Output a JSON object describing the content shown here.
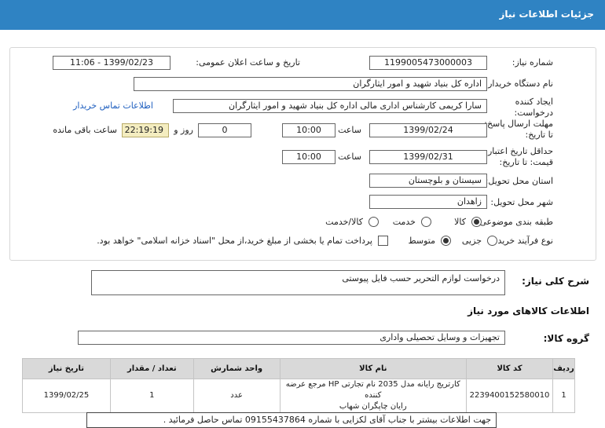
{
  "header": {
    "title": "جزئیات اطلاعات نیاز"
  },
  "form": {
    "need_number_label": "شماره نیاز:",
    "need_number": "1199005473000003",
    "announce_label": "تاریخ و ساعت اعلان عمومی:",
    "announce_value": "1399/02/23 - 11:06",
    "buyer_label": "نام دستگاه خریدار:",
    "buyer_value": "اداره کل بنیاد شهید و امور ایثارگران",
    "creator_label_1": "ایجاد کننده",
    "creator_label_2": "درخواست:",
    "creator_value": "سارا کریمی کارشناس اداری مالی اداره کل بنیاد شهید و امور ایثارگران",
    "contact_link": "اطلاعات تماس خریدار",
    "reply_label_1": "مهلت ارسال پاسخ:",
    "reply_label_2": "تا تاریخ:",
    "reply_date": "1399/02/24",
    "time_label": "ساعت",
    "reply_time": "10:00",
    "days_value": "0",
    "days_label": "روز و",
    "remaining_value": "22:19:19",
    "remaining_label": "ساعت باقی مانده",
    "validity_label_1": "حداقل تاریخ اعتبار",
    "validity_label_2": "قیمت: تا تاریخ:",
    "validity_date": "1399/02/31",
    "validity_time": "10:00",
    "province_label": "استان محل تحویل:",
    "province_value": "سیستان و بلوچستان",
    "city_label": "شهر محل تحویل:",
    "city_value": "زاهدان",
    "category_label": "طبقه بندی موضوعی:",
    "category_options": [
      "کالا",
      "خدمت",
      "کالا/خدمت"
    ],
    "category_selected": "کالا",
    "process_label": "نوع فرآیند خرید :",
    "process_options": [
      "جزیی",
      "متوسط"
    ],
    "process_selected": "متوسط",
    "payment_text": "پرداخت تمام یا بخشی از مبلغ خرید،از محل \"اسناد خزانه اسلامی\" خواهد بود."
  },
  "description": {
    "label": "شرح کلی نیاز:",
    "value": "درخواست لوازم التحریر حسب فایل پیوستی"
  },
  "goods_section_title": "اطلاعات کالاهای مورد نیاز",
  "goods_group": {
    "label": "گروه کالا:",
    "value": "تجهیزات و وسایل تحصیلی واداری"
  },
  "table": {
    "headers": [
      "ردیف",
      "کد کالا",
      "نام کالا",
      "واحد شمارش",
      "تعداد / مقدار",
      "تاریخ نیاز"
    ],
    "rows": [
      {
        "index": "1",
        "code": "2239400152580010",
        "name_line1": "کارتریج رایانه مدل 2035 نام تجارتی HP مرجع عرضه کننده",
        "name_line2": "رایان چاپگران شهاب",
        "unit": "عدد",
        "qty": "1",
        "date": "1399/02/25"
      }
    ]
  },
  "footer_note": "جهت اطلاعات بیشتر با جناب آقای لکزایی با شماره 09155437864 تماس حاصل فرمائید ."
}
